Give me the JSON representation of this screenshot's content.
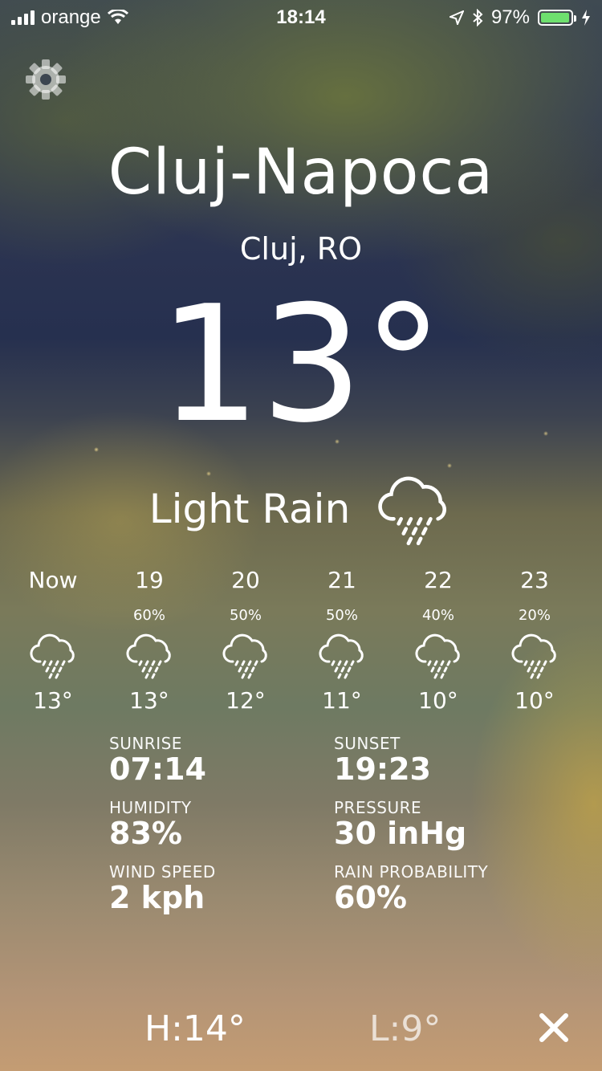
{
  "status_bar": {
    "carrier": "orange",
    "time": "18:14",
    "battery_percent": "97%",
    "battery_level": 0.97,
    "battery_color": "#6ee06e"
  },
  "location": {
    "city": "Cluj-Napoca",
    "region": "Cluj, RO"
  },
  "current": {
    "temperature": "13°",
    "condition": "Light Rain",
    "icon": "rain-cloud-icon"
  },
  "hourly": [
    {
      "time": "Now",
      "precip": "",
      "temp": "13°",
      "icon": "rain-cloud-icon"
    },
    {
      "time": "19",
      "precip": "60%",
      "temp": "13°",
      "icon": "rain-cloud-icon"
    },
    {
      "time": "20",
      "precip": "50%",
      "temp": "12°",
      "icon": "rain-cloud-icon"
    },
    {
      "time": "21",
      "precip": "50%",
      "temp": "11°",
      "icon": "rain-cloud-icon"
    },
    {
      "time": "22",
      "precip": "40%",
      "temp": "10°",
      "icon": "rain-cloud-icon"
    },
    {
      "time": "23",
      "precip": "20%",
      "temp": "10°",
      "icon": "rain-cloud-icon"
    }
  ],
  "details": {
    "sunrise": {
      "label": "SUNRISE",
      "value": "07:14"
    },
    "sunset": {
      "label": "SUNSET",
      "value": "19:23"
    },
    "humidity": {
      "label": "HUMIDITY",
      "value": "83%"
    },
    "pressure": {
      "label": "PRESSURE",
      "value": "30 inHg"
    },
    "wind": {
      "label": "WIND SPEED",
      "value": "2 kph"
    },
    "rain": {
      "label": "RAIN PROBABILITY",
      "value": "60%"
    }
  },
  "high_low": {
    "high": "H:14°",
    "low": "L:9°"
  }
}
